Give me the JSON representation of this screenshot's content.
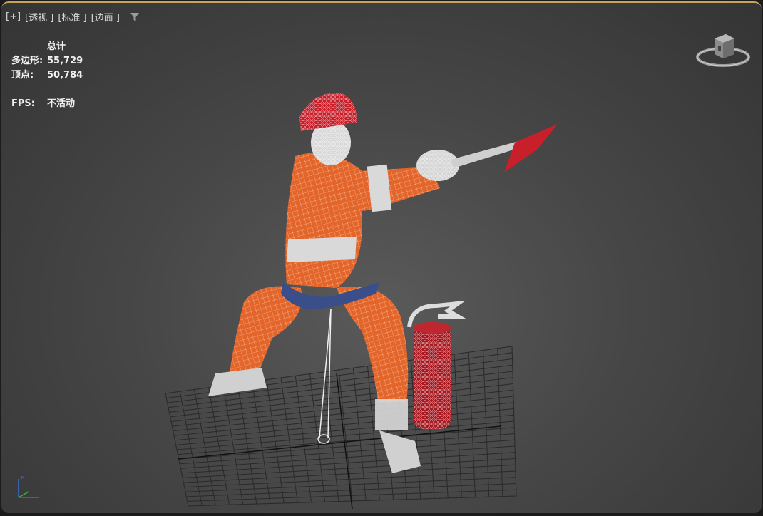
{
  "viewport": {
    "labels": [
      "[+]",
      "[透视 ]",
      "[标准 ]",
      "[边面 ]"
    ],
    "filter_icon": "filter-icon"
  },
  "stats": {
    "title": "总计",
    "polygons_label": "多边形:",
    "polygons_value": "55,729",
    "vertices_label": "顶点:",
    "vertices_value": "50,784",
    "fps_label": "FPS:",
    "fps_value": "不活动"
  },
  "viewcube": {
    "icon": "viewcube-icon"
  },
  "axis": {
    "z_label": "z",
    "icon": "axis-tripod-icon"
  },
  "colors": {
    "accent": "#c8a35a",
    "suit": "#e86a2a",
    "reflective": "#d9d9d9",
    "belt": "#3a4f8a",
    "extinguisher": "#a81a22"
  }
}
